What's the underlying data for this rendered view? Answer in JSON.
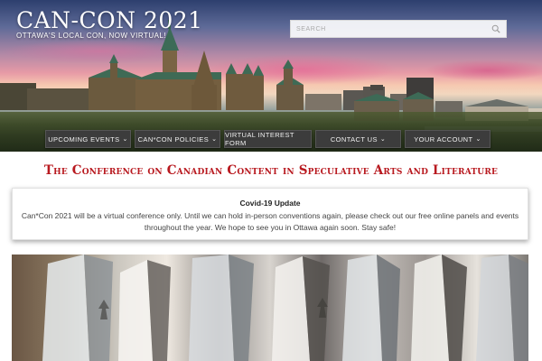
{
  "header": {
    "title": "CAN-CON 2021",
    "tagline": "OTTAWA'S LOCAL CON, NOW VIRTUAL!",
    "search_placeholder": "SEARCH",
    "search_icon": "search-icon"
  },
  "nav": {
    "items": [
      {
        "label": "UPCOMING EVENTS",
        "dropdown": true
      },
      {
        "label": "CAN*CON POLICIES",
        "dropdown": true
      },
      {
        "label": "VIRTUAL INTEREST FORM",
        "dropdown": false
      },
      {
        "label": "CONTACT US",
        "dropdown": true
      },
      {
        "label": "YOUR ACCOUNT",
        "dropdown": true
      }
    ],
    "chevron": "⌄"
  },
  "main": {
    "heading": "The Conference on Canadian Content in Speculative Arts and Literature",
    "notice": {
      "title": "Covid-19 Update",
      "body_line1": "Can*Con 2021 will be a virtual conference only. Until we can hold in-person conventions again, please check out our free online panels and events",
      "body_line2": "throughout the year. We hope to see you in Ottawa again soon. Stay safe!"
    }
  },
  "colors": {
    "heading": "#b8191f",
    "nav_bg": "#3c3c3c"
  }
}
